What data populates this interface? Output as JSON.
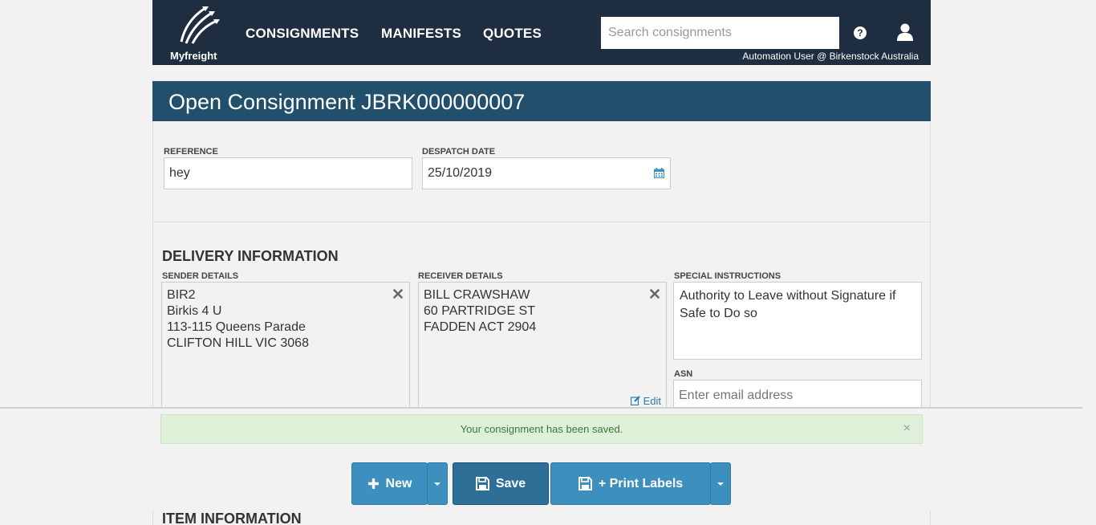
{
  "header": {
    "logo_text": "Myfreight",
    "nav": [
      "CONSIGNMENTS",
      "MANIFESTS",
      "QUOTES"
    ],
    "search_placeholder": "Search consignments",
    "user_text": "Automation User @ Birkenstock Australia",
    "help_glyph": "?"
  },
  "page": {
    "title": "Open Consignment JBRK000000007"
  },
  "form": {
    "reference_label": "REFERENCE",
    "reference_value": "hey",
    "despatch_label": "DESPATCH DATE",
    "despatch_value": "25/10/2019"
  },
  "delivery": {
    "section_title": "DELIVERY INFORMATION",
    "sender_label": "SENDER DETAILS",
    "sender_lines": [
      "BIR2",
      "Birkis 4 U",
      "113-115 Queens Parade",
      "CLIFTON HILL VIC 3068"
    ],
    "receiver_label": "RECEIVER DETAILS",
    "receiver_lines": [
      "BILL CRAWSHAW",
      "60 PARTRIDGE ST",
      "FADDEN ACT 2904"
    ],
    "edit_label": "Edit",
    "special_label": "SPECIAL INSTRUCTIONS",
    "special_value": "Authority to Leave without Signature if Safe to Do so",
    "asn_label": "ASN",
    "asn_placeholder": "Enter email address"
  },
  "alert": {
    "message": "Your consignment has been saved.",
    "close": "×"
  },
  "actions": {
    "new_label": "New",
    "save_label": "Save",
    "print_label": "+ Print Labels"
  },
  "items": {
    "section_title": "ITEM INFORMATION"
  },
  "colors": {
    "header_bg": "#1e2d3f",
    "title_bg": "#214f6c",
    "button": "#3d8fbd",
    "alert_bg": "#dff0d8"
  }
}
